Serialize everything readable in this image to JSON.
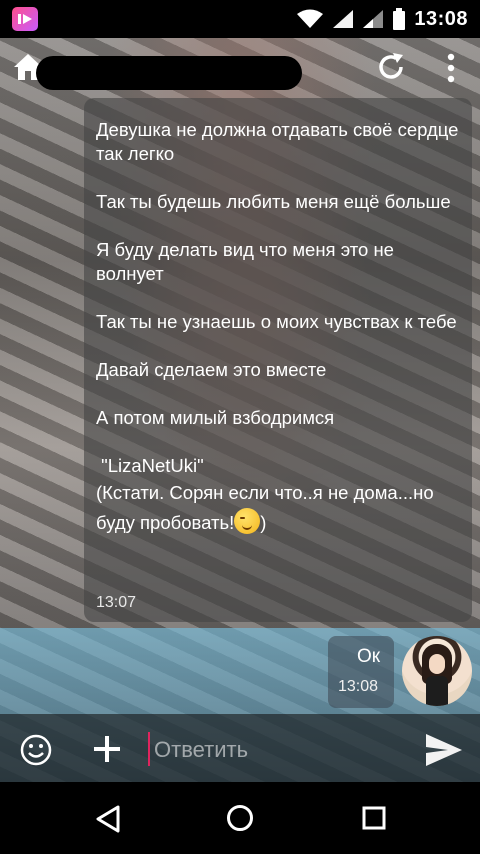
{
  "status_bar": {
    "time": "13:08",
    "icons": [
      "app-badge-icon",
      "wifi-icon",
      "signal-icon",
      "signal-icon",
      "battery-icon"
    ]
  },
  "toolbar": {
    "title": "",
    "icons": [
      "home-icon",
      "refresh-icon",
      "more-vertical-icon"
    ]
  },
  "chat": {
    "incoming": {
      "lines": [
        "Девушка не должна отдавать своё сердце так легко",
        "Так ты будешь любить меня ещё больше",
        "Я буду делать вид что меня это не волнует",
        "Так ты не узнаешь о моих чувствах к тебе",
        "Давай сделаем это вместе",
        "А потом милый взбодримся"
      ],
      "signature": " \"LizaNetUki\"",
      "note": "(Кстати. Сорян если что..я не дома...но буду пробовать!",
      "note_end": ")",
      "emoji": "wink-emoji-icon",
      "time": "13:07"
    },
    "outgoing": {
      "text": "Ок",
      "time": "13:08"
    }
  },
  "input": {
    "placeholder": "Ответить"
  },
  "nav": {
    "icons": [
      "back-icon",
      "home-circle-icon",
      "recents-icon"
    ]
  },
  "colors": {
    "accent_cursor": "#e0245e",
    "bubble_in": "#464646",
    "tint": "#78bedc"
  }
}
